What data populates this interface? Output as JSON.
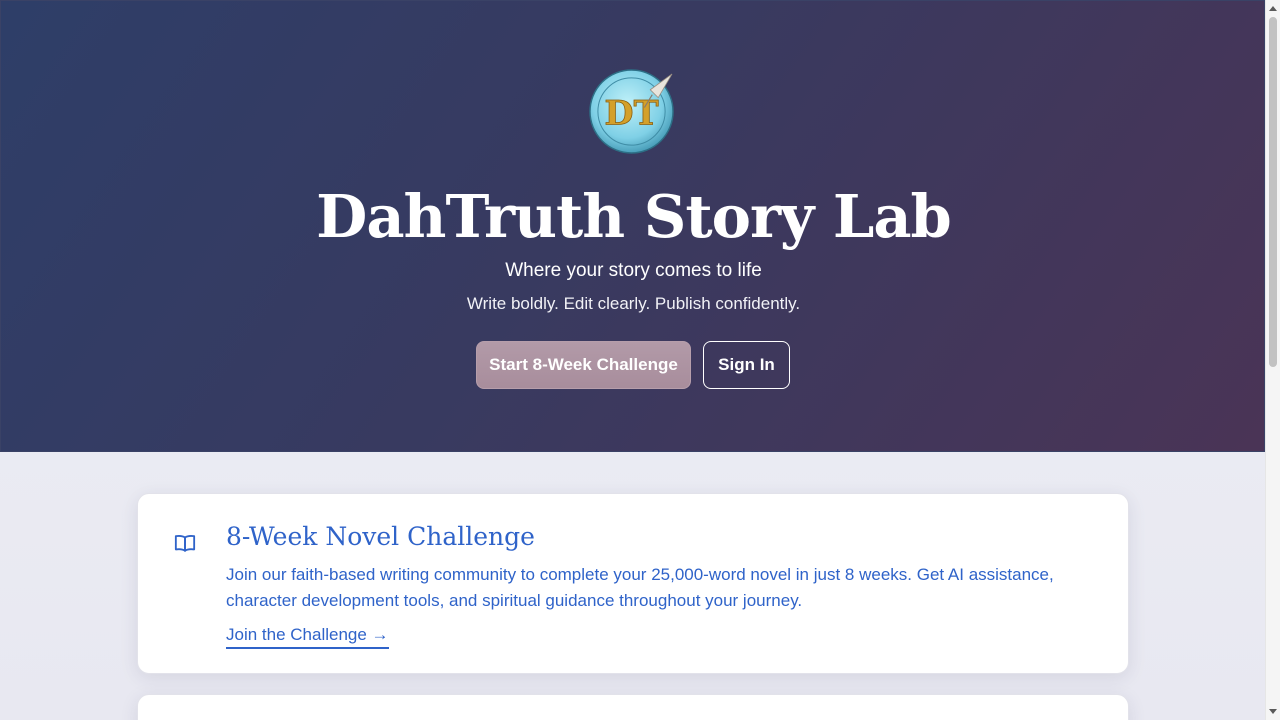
{
  "hero": {
    "logo_icon": "dahtruth-logo-icon",
    "logo_colors": {
      "badge": "#7fd0e6",
      "monogram": "#d4a02a"
    },
    "title": "DahTruth Story Lab",
    "subtitle": "Where your story comes to life",
    "tagline": "Write boldly. Edit clearly. Publish confidently.",
    "primary_button": "Start 8-Week Challenge",
    "secondary_button": "Sign In",
    "colors": {
      "gradient_start": "#2e3e68",
      "gradient_end": "#4a3456",
      "primary_button": "#ab919f"
    }
  },
  "cards": [
    {
      "icon": "book-icon",
      "title": "8-Week Novel Challenge",
      "description": "Join our faith-based writing community to complete your 25,000-word novel in just 8 weeks. Get AI assistance, character development tools, and spiritual guidance throughout your journey.",
      "link": "Join the Challenge →",
      "accent": "#2f63c9"
    }
  ]
}
